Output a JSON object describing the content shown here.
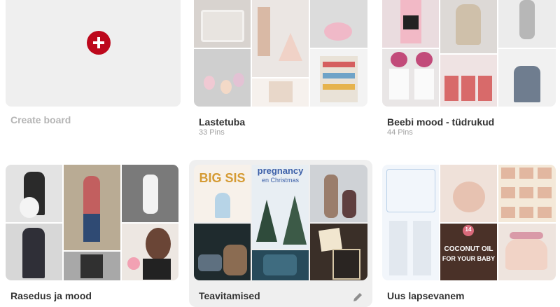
{
  "create": {
    "label": "Create board",
    "icon": "plus-icon",
    "accent": "#bd081c"
  },
  "boards": [
    {
      "title": "Lastetuba",
      "pins": "33 Pins"
    },
    {
      "title": "Beebi mood - tüdrukud",
      "pins": "44 Pins"
    },
    {
      "title": "Rasedus ja mood"
    },
    {
      "title": "Teavitamised"
    },
    {
      "title": "Uus lapsevanem"
    }
  ],
  "image_text": {
    "big_sis": "BIG SIS",
    "pregnancy": "pregnancy",
    "en_christmas": "en Christmas",
    "coconut_number": "14",
    "coconut_l1": "COCONUT OIL",
    "coconut_l2": "FOR YOUR BABY"
  },
  "edit_icon": "pencil-icon"
}
